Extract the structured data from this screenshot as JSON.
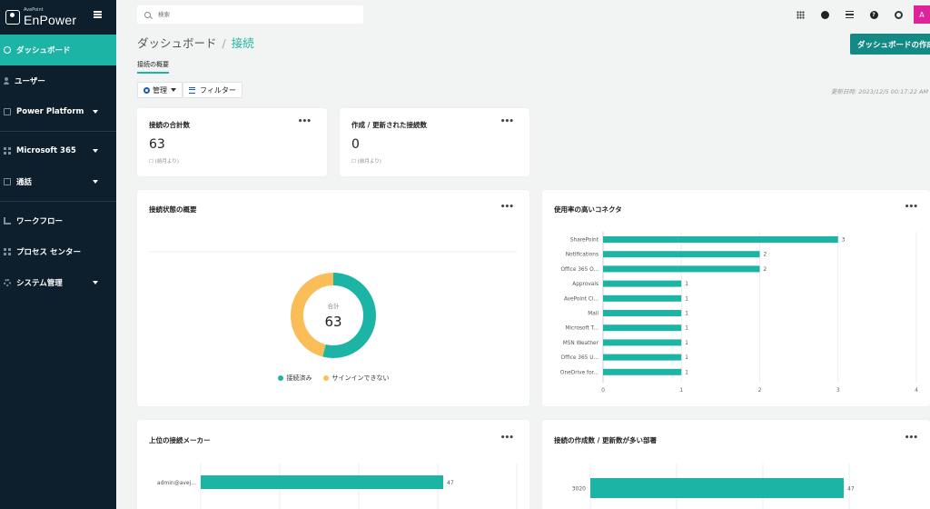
{
  "brand": {
    "sub": "AvePoint",
    "name": "EnPower"
  },
  "sidebar": {
    "items": [
      {
        "label": "ダッシュボード",
        "icon": "dashboard-icon"
      },
      {
        "label": "ユーザー",
        "icon": "user-icon"
      },
      {
        "label": "Power Platform",
        "icon": "square-icon"
      },
      {
        "label": "Microsoft 365",
        "icon": "grid-icon"
      },
      {
        "label": "通話",
        "icon": "square-icon"
      },
      {
        "label": "ワークフロー",
        "icon": "flow-icon"
      },
      {
        "label": "プロセス センター",
        "icon": "grid-icon"
      },
      {
        "label": "システム管理",
        "icon": "gear-icon"
      }
    ]
  },
  "search": {
    "placeholder": "検索"
  },
  "header": {
    "breadcrumb_parent": "ダッシュボード",
    "breadcrumb_sep": "/",
    "breadcrumb_current": "接続",
    "create_label": "ダッシュボードの作成"
  },
  "subtab": {
    "label": "接続の概要"
  },
  "toolbar": {
    "manage_label": "管理",
    "filter_label": "フィルター"
  },
  "updated": {
    "label": "更新日時: 2023/12/5 00:17:22 AM"
  },
  "more_label": "•••",
  "stats": [
    {
      "title": "接続の合計数",
      "value": "63",
      "sub": "☐ (前月より)"
    },
    {
      "title": "作成 / 更新された接続数",
      "value": "0",
      "sub": "☐ (前月より)"
    }
  ],
  "status_card": {
    "title": "接続状態の概要",
    "center_label": "合計",
    "center_value": "63",
    "legend": [
      {
        "label": "接続済み",
        "color": "#1cb5a5"
      },
      {
        "label": "サインインできない",
        "color": "#f9be57"
      }
    ],
    "chart_data": {
      "type": "pie",
      "categories": [
        "接続済み",
        "サインインできない"
      ],
      "values": [
        34,
        29
      ],
      "colors": [
        "#1cb5a5",
        "#f9be57"
      ]
    }
  },
  "connectors_card": {
    "title": "使用率の高いコネクタ",
    "chart_data": {
      "type": "bar",
      "orientation": "horizontal",
      "categories": [
        "SharePoint",
        "Notifications",
        "Office 365 O...",
        "Approvals",
        "AvePoint Cl...",
        "Mail",
        "Microsoft T...",
        "MSN Weather",
        "Office 365 U...",
        "OneDrive for..."
      ],
      "values": [
        3,
        2,
        2,
        1,
        1,
        1,
        1,
        1,
        1,
        1
      ],
      "xticks": [
        "0",
        "1",
        "2",
        "3",
        "4"
      ],
      "xlim": [
        0,
        4
      ],
      "color": "#1cb5a5"
    }
  },
  "makers_card": {
    "title": "上位の接続メーカー",
    "chart_data": {
      "type": "bar",
      "orientation": "horizontal",
      "categories": [
        "admin@avej..."
      ],
      "values": [
        47
      ],
      "color": "#1cb5a5"
    }
  },
  "departments_card": {
    "title": "接続の作成数 / 更新数が多い部署",
    "chart_data": {
      "type": "bar",
      "orientation": "horizontal",
      "categories": [
        "3020"
      ],
      "values": [
        47
      ],
      "color": "#1cb5a5"
    }
  }
}
